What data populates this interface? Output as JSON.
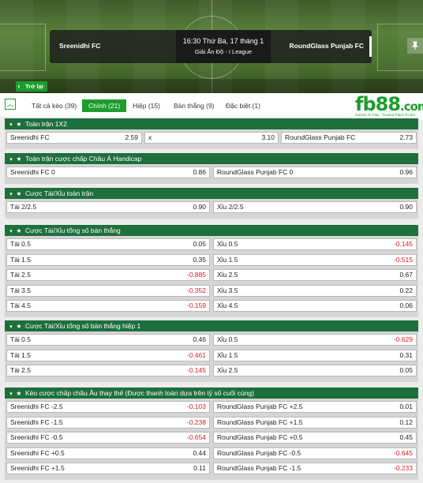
{
  "match": {
    "home": "Sreenidhi FC",
    "away": "RoundGlass Punjab FC",
    "kickoff": "16:30 Thứ Ba, 17 tháng 1",
    "league": "Giải Ấn Độ - I League"
  },
  "back_label": "Trở lại",
  "tabs": [
    "Tất cả kèo (39)",
    "Chính (21)",
    "Hiệp (15)",
    "Bàn thắng (9)",
    "Đặc biệt (1)"
  ],
  "active_tab": "Chính (21)",
  "logo": {
    "text": "fb88",
    "suffix": ".com",
    "tagline": "Games To Play · Trusted Place To Bet"
  },
  "colors": {
    "accent": "#1c9d2e",
    "section": "#1d6f3c",
    "negative": "#e01818"
  },
  "icons": [
    "chevron-up-icon",
    "star-icon",
    "chevron-left-icon",
    "pin-icon"
  ],
  "sections": [
    {
      "title": "Toàn trận 1X2",
      "rows": [
        [
          {
            "label": "Sreenidhi FC",
            "value": "2.59"
          },
          {
            "label": "x",
            "value": "3.10"
          },
          {
            "label": "RoundGlass Punjab FC",
            "value": "2.73"
          }
        ]
      ]
    },
    {
      "title": "Toàn trận cược chấp Châu Á Handicap",
      "rows": [
        [
          {
            "label": "Sreenidhi FC 0",
            "value": "0.86"
          },
          {
            "label": "RoundGlass Punjab FC 0",
            "value": "0.96"
          }
        ]
      ]
    },
    {
      "title": "Cược Tài/Xỉu toàn trận",
      "rows": [
        [
          {
            "label": "Tài 2/2.5",
            "value": "0.90"
          },
          {
            "label": "Xỉu 2/2.5",
            "value": "0.90"
          }
        ]
      ]
    },
    {
      "title": "Cược Tài/Xỉu tổng số bàn thắng",
      "rows": [
        [
          {
            "label": "Tài 0.5",
            "value": "0.05"
          },
          {
            "label": "Xỉu 0.5",
            "value": "-0.145"
          }
        ],
        [
          {
            "label": "Tài 1.5",
            "value": "0.35"
          },
          {
            "label": "Xỉu 1.5",
            "value": "-0.515"
          }
        ],
        [
          {
            "label": "Tài 2.5",
            "value": "-0.885"
          },
          {
            "label": "Xỉu 2.5",
            "value": "0.67"
          }
        ],
        [
          {
            "label": "Tài 3.5",
            "value": "-0.352"
          },
          {
            "label": "Xỉu 3.5",
            "value": "0.22"
          }
        ],
        [
          {
            "label": "Tài 4.5",
            "value": "-0.159"
          },
          {
            "label": "Xỉu 4.5",
            "value": "0.06"
          }
        ]
      ]
    },
    {
      "title": "Cược Tài/Xỉu tổng số bàn thắng hiệp 1",
      "rows": [
        [
          {
            "label": "Tài 0.5",
            "value": "0.46"
          },
          {
            "label": "Xỉu 0.5",
            "value": "-0.629"
          }
        ],
        [
          {
            "label": "Tài 1.5",
            "value": "-0.461"
          },
          {
            "label": "Xỉu 1.5",
            "value": "0.31"
          }
        ],
        [
          {
            "label": "Tài 2.5",
            "value": "-0.145"
          },
          {
            "label": "Xỉu 2.5",
            "value": "0.05"
          }
        ]
      ]
    },
    {
      "title": "Kèo cược chấp châu Âu thay thế (Được thanh toán dựa trên tỷ số cuối cùng)",
      "rows": [
        [
          {
            "label": "Sreenidhi FC -2.5",
            "value": "-0.103"
          },
          {
            "label": "RoundGlass Punjab FC +2.5",
            "value": "0.01"
          }
        ],
        [
          {
            "label": "Sreenidhi FC -1.5",
            "value": "-0.238"
          },
          {
            "label": "RoundGlass Punjab FC +1.5",
            "value": "0.12"
          }
        ],
        [
          {
            "label": "Sreenidhi FC -0.5",
            "value": "-0.654"
          },
          {
            "label": "RoundGlass Punjab FC +0.5",
            "value": "0.45"
          }
        ],
        [
          {
            "label": "Sreenidhi FC +0.5",
            "value": "0.44"
          },
          {
            "label": "RoundGlass Punjab FC -0.5",
            "value": "-0.645"
          }
        ],
        [
          {
            "label": "Sreenidhi FC +1.5",
            "value": "0.11"
          },
          {
            "label": "RoundGlass Punjab FC -1.5",
            "value": "-0.233"
          }
        ]
      ]
    }
  ]
}
